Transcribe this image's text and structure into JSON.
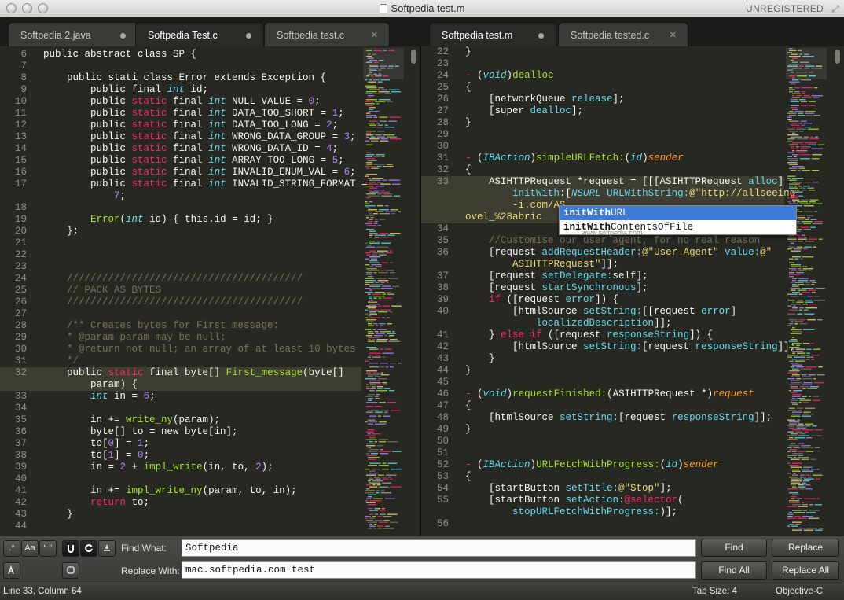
{
  "window": {
    "title": "Softpedia test.m",
    "registration": "UNREGISTERED"
  },
  "tabs_left": [
    {
      "label": "Softpedia 2.java",
      "state": "modified"
    },
    {
      "label": "Softpedia Test.c",
      "state": "modified"
    },
    {
      "label": "Softpedia test.c",
      "state": "close"
    }
  ],
  "tabs_right": [
    {
      "label": "Softpedia test.m",
      "state": "modified"
    },
    {
      "label": "Softpedia tested.c",
      "state": "close"
    }
  ],
  "left_editor": {
    "current_line": "32",
    "lines": [
      {
        "n": "6",
        "html": "<span class=\"k\"></span>public abstract class SP {"
      },
      {
        "n": "7",
        "html": ""
      },
      {
        "n": "8",
        "html": "    public stati class Error extends Exception {"
      },
      {
        "n": "9",
        "html": "        public final <span class=\"t\">int</span> id;"
      },
      {
        "n": "10",
        "html": "        public <span class=\"k\">static</span> final <span class=\"t\">int</span> NULL_VALUE = <span class=\"n\">0</span>;"
      },
      {
        "n": "11",
        "html": "        public <span class=\"k\">static</span> final <span class=\"t\">int</span> DATA_TOO_SHORT = <span class=\"n\">1</span>;"
      },
      {
        "n": "12",
        "html": "        public <span class=\"k\">static</span> final <span class=\"t\">int</span> DATA_TOO_LONG = <span class=\"n\">2</span>;"
      },
      {
        "n": "13",
        "html": "        public <span class=\"k\">static</span> final <span class=\"t\">int</span> WRONG_DATA_GROUP = <span class=\"n\">3</span>;"
      },
      {
        "n": "14",
        "html": "        public <span class=\"k\">static</span> final <span class=\"t\">int</span> WRONG_DATA_ID = <span class=\"n\">4</span>;"
      },
      {
        "n": "15",
        "html": "        public <span class=\"k\">static</span> final <span class=\"t\">int</span> ARRAY_TOO_LONG = <span class=\"n\">5</span>;"
      },
      {
        "n": "16",
        "html": "        public <span class=\"k\">static</span> final <span class=\"t\">int</span> INVALID_ENUM_VAL = <span class=\"n\">6</span>;"
      },
      {
        "n": "17",
        "html": "        public <span class=\"k\">static</span> final <span class=\"t\">int</span> INVALID_STRING_FORMAT ="
      },
      {
        "n": "",
        "html": "            <span class=\"n\">7</span>;"
      },
      {
        "n": "18",
        "html": ""
      },
      {
        "n": "19",
        "html": "        <span class=\"f\">Error</span>(<span class=\"t\">int</span> id) { this.id = id; }"
      },
      {
        "n": "20",
        "html": "    };"
      },
      {
        "n": "21",
        "html": ""
      },
      {
        "n": "22",
        "html": ""
      },
      {
        "n": "23",
        "html": ""
      },
      {
        "n": "24",
        "html": "    <span class=\"c\">////////////////////////////////////////</span>"
      },
      {
        "n": "25",
        "html": "    <span class=\"c\">// PACK AS BYTES</span>"
      },
      {
        "n": "26",
        "html": "    <span class=\"c\">////////////////////////////////////////</span>"
      },
      {
        "n": "27",
        "html": ""
      },
      {
        "n": "28",
        "html": "    <span class=\"c\">/** Creates bytes for First_message:</span>"
      },
      {
        "n": "29",
        "html": "    <span class=\"c\">* @param param may be null;</span>"
      },
      {
        "n": "30",
        "html": "    <span class=\"c\">* @return not null; an array of at least 10 bytes</span>"
      },
      {
        "n": "31",
        "html": "    <span class=\"c\">*/</span>"
      },
      {
        "n": "32",
        "html": "    public <span class=\"k\">static</span> final byte[] <span class=\"f\">First_message</span>(byte[]"
      },
      {
        "n": "",
        "html": "        param) {"
      },
      {
        "n": "33",
        "html": "        <span class=\"t\">int</span> in = <span class=\"n\">6</span>;"
      },
      {
        "n": "34",
        "html": ""
      },
      {
        "n": "35",
        "html": "        in += <span class=\"f\">write_ny</span>(param);"
      },
      {
        "n": "36",
        "html": "        byte[] to = new byte[in];"
      },
      {
        "n": "37",
        "html": "        to[<span class=\"n\">0</span>] = <span class=\"n\">1</span>;"
      },
      {
        "n": "38",
        "html": "        to[<span class=\"n\">1</span>] = <span class=\"n\">0</span>;"
      },
      {
        "n": "39",
        "html": "        in = <span class=\"n\">2</span> + <span class=\"f\">impl_write</span>(in, to, <span class=\"n\">2</span>);"
      },
      {
        "n": "40",
        "html": ""
      },
      {
        "n": "41",
        "html": "        in += <span class=\"f\">impl_write_ny</span>(param, to, in);"
      },
      {
        "n": "42",
        "html": "        <span class=\"k\">return</span> to;"
      },
      {
        "n": "43",
        "html": "    }"
      },
      {
        "n": "44",
        "html": ""
      }
    ]
  },
  "right_editor": {
    "current_line": "33",
    "lines": [
      {
        "n": "22",
        "html": "}"
      },
      {
        "n": "23",
        "html": ""
      },
      {
        "n": "24",
        "html": "<span class=\"k\">-</span> (<span class=\"t\">void</span>)<span class=\"f\">dealloc</span>"
      },
      {
        "n": "25",
        "html": "{"
      },
      {
        "n": "26",
        "html": "    [networkQueue <span class=\"m\">release</span>];"
      },
      {
        "n": "27",
        "html": "    [super <span class=\"m\">dealloc</span>];"
      },
      {
        "n": "28",
        "html": "}"
      },
      {
        "n": "29",
        "html": ""
      },
      {
        "n": "30",
        "html": ""
      },
      {
        "n": "31",
        "html": "<span class=\"k\">-</span> (<span class=\"t\">IBAction</span>)<span class=\"f\">simpleURLFetch:</span>(<span class=\"t\">id</span>)<span class=\"p\">sender</span>"
      },
      {
        "n": "32",
        "html": "{"
      },
      {
        "n": "33",
        "html": "    ASIHTTPRequest *request = [[[ASIHTTPRequest <span class=\"m\">alloc</span>]"
      },
      {
        "n": "",
        "html": "        <span class=\"m\">initWith</span>:[<span class=\"t\">NSURL</span> <span class=\"m\">URLWithString:</span><span class=\"s\">@\"http://allseeing</span>"
      },
      {
        "n": "",
        "html": "        <span class=\"s\">-i.com/AS</span>"
      },
      {
        "n": "",
        "html": "<span class=\"s\">ovel_%28abric</span>"
      },
      {
        "n": "34",
        "html": ""
      },
      {
        "n": "35",
        "html": "    <span class=\"c\">//Customise our user agent, for no real reason</span>"
      },
      {
        "n": "36",
        "html": "    [request <span class=\"m\">addRequestHeader:</span><span class=\"s\">@\"User-Agent\"</span> <span class=\"m\">value:</span><span class=\"s\">@\"</span>"
      },
      {
        "n": "",
        "html": "        <span class=\"s\">ASIHTTPRequest\"</span>]];"
      },
      {
        "n": "37",
        "html": "    [request <span class=\"m\">setDelegate:</span>self];"
      },
      {
        "n": "38",
        "html": "    [request <span class=\"m\">startSynchronous</span>];"
      },
      {
        "n": "39",
        "html": "    <span class=\"k\">if</span> ([request <span class=\"m\">error</span>]) {"
      },
      {
        "n": "40",
        "html": "        [htmlSource <span class=\"m\">setString:</span>[[request <span class=\"m\">error</span>]"
      },
      {
        "n": "",
        "html": "            <span class=\"m\">localizedDescription</span>]];"
      },
      {
        "n": "41",
        "html": "    } <span class=\"k\">else if</span> ([request <span class=\"m\">responseString</span>]) {"
      },
      {
        "n": "42",
        "html": "        [htmlSource <span class=\"m\">setString:</span>[request <span class=\"m\">responseString</span>]];"
      },
      {
        "n": "43",
        "html": "    }"
      },
      {
        "n": "44",
        "html": "}"
      },
      {
        "n": "45",
        "html": ""
      },
      {
        "n": "46",
        "html": "<span class=\"k\">-</span> (<span class=\"t\">void</span>)<span class=\"f\">requestFinished:</span>(ASIHTTPRequest *)<span class=\"p\">request</span>"
      },
      {
        "n": "47",
        "html": "{"
      },
      {
        "n": "48",
        "html": "    [htmlSource <span class=\"m\">setString:</span>[request <span class=\"m\">responseString</span>]];"
      },
      {
        "n": "49",
        "html": "}"
      },
      {
        "n": "50",
        "html": ""
      },
      {
        "n": "51",
        "html": ""
      },
      {
        "n": "52",
        "html": "<span class=\"k\">-</span> (<span class=\"t\">IBAction</span>)<span class=\"f\">URLFetchWithProgress:</span>(<span class=\"t\">id</span>)<span class=\"p\">sender</span>"
      },
      {
        "n": "53",
        "html": "{"
      },
      {
        "n": "54",
        "html": "    [startButton <span class=\"m\">setTitle:</span><span class=\"s\">@\"Stop\"</span>];"
      },
      {
        "n": "55",
        "html": "    [startButton <span class=\"m\">setAction:</span><span class=\"k\">@selector</span>("
      },
      {
        "n": "",
        "html": "        <span class=\"m\">stopURLFetchWithProgress:</span>)];"
      },
      {
        "n": "56",
        "html": ""
      }
    ]
  },
  "autocomplete": {
    "items": [
      {
        "bold": "initWith",
        "rest": "URL",
        "selected": true
      },
      {
        "bold": "initWith",
        "rest": "ContentsOfFile",
        "selected": false
      }
    ]
  },
  "watermark": "www.softpedia.com",
  "find_panel": {
    "option_regex": ".*",
    "option_case": "Aa",
    "option_word": "“ ”",
    "find_label": "Find What:",
    "find_value": "Softpedia",
    "replace_label": "Replace With:",
    "replace_value": "mac.softpedia.com test",
    "find_button": "Find",
    "replace_button": "Replace",
    "find_all_button": "Find All",
    "replace_all_button": "Replace All"
  },
  "status": {
    "position": "Line 33, Column 64",
    "tab_size": "Tab Size: 4",
    "syntax": "Objective-C"
  }
}
